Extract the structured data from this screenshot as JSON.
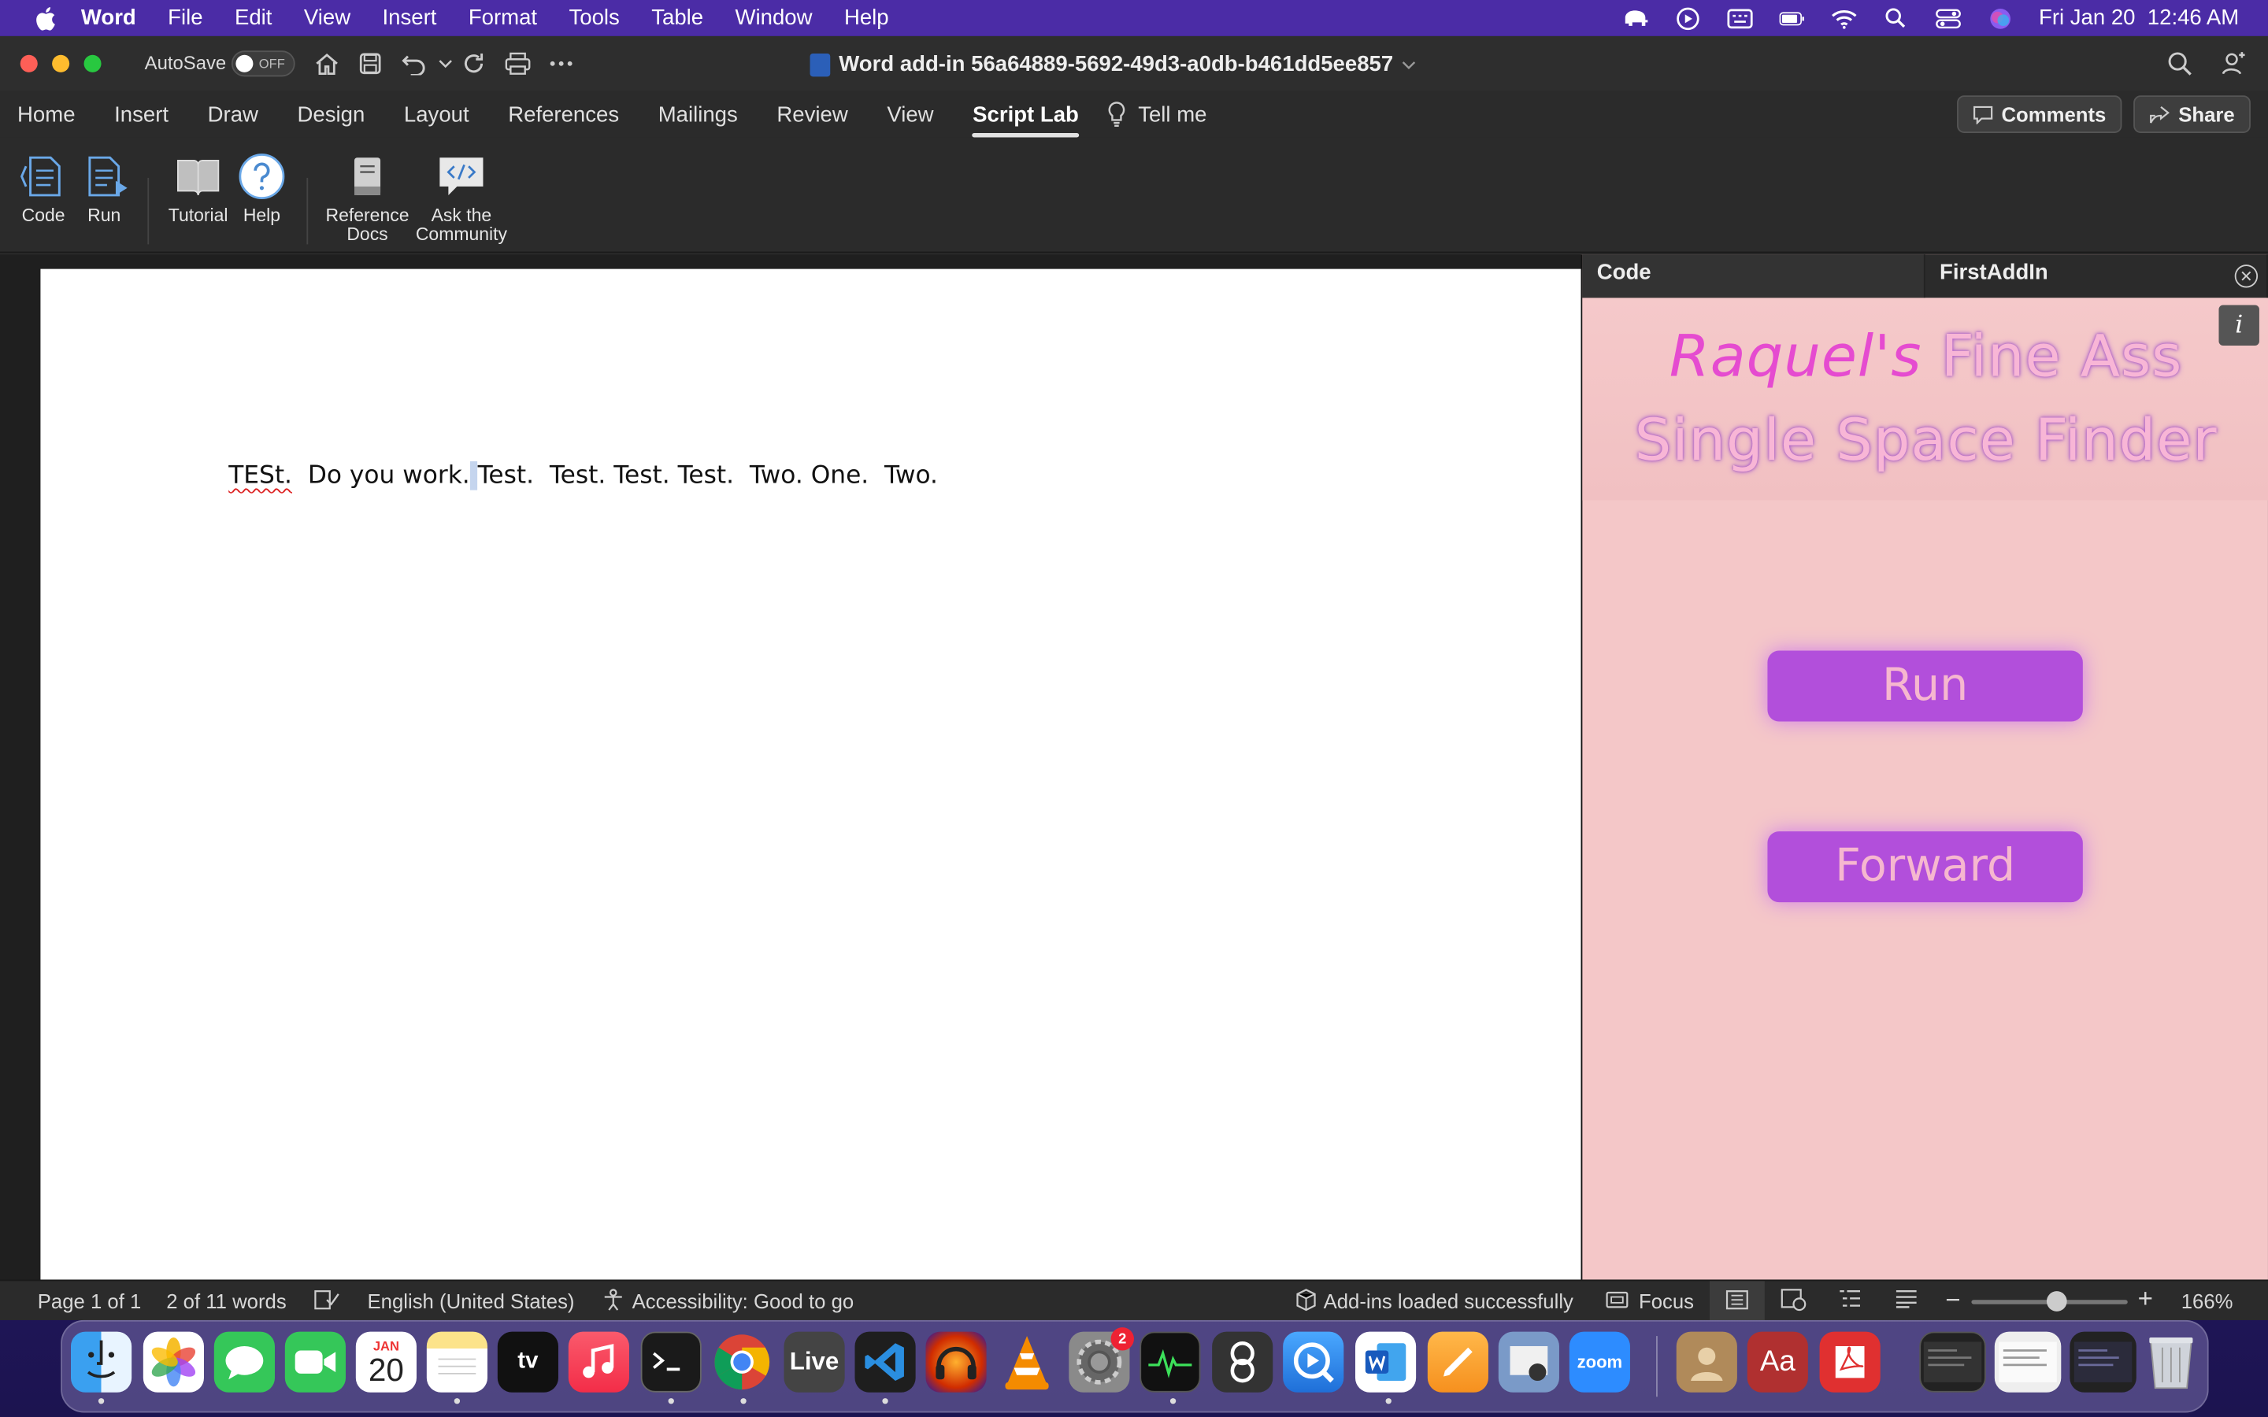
{
  "menubar": {
    "app_name": "Word",
    "items": [
      "File",
      "Edit",
      "View",
      "Insert",
      "Format",
      "Tools",
      "Table",
      "Window",
      "Help"
    ],
    "clock": "Fri Jan 20  12:46 AM"
  },
  "titlebar": {
    "autosave_label": "AutoSave",
    "toggle_state": "OFF",
    "doc_title": "Word add-in 56a64889-5692-49d3-a0db-b461dd5ee857"
  },
  "tabs": {
    "items": [
      "Home",
      "Insert",
      "Draw",
      "Design",
      "Layout",
      "References",
      "Mailings",
      "Review",
      "View",
      "Script Lab"
    ],
    "tell_me": "Tell me",
    "comments": "Comments",
    "share": "Share"
  },
  "ribbon": {
    "code": "Code",
    "run": "Run",
    "tutorial": "Tutorial",
    "help": "Help",
    "reference_docs_1": "Reference",
    "reference_docs_2": "Docs",
    "ask_1": "Ask the",
    "ask_2": "Community"
  },
  "document": {
    "word1": "TESt.",
    "text_a": "  Do you work.",
    "selected": " ",
    "text_b": "Test.  Test. Test. Test.  Two. One.  Two."
  },
  "pane": {
    "tab_code": "Code",
    "tab_addin": "FirstAddIn",
    "heading_name": "Raquel's",
    "heading_rest1": " Fine Ass",
    "heading_line2": "Single Space Finder",
    "run_button": "Run",
    "forward_button": "Forward"
  },
  "status": {
    "page": "Page 1 of 1",
    "words": "2 of 11 words",
    "language": "English (United States)",
    "accessibility": "Accessibility: Good to go",
    "addins": "Add-ins loaded successfully",
    "focus": "Focus",
    "zoom": "166%",
    "zoom_level": 0.55
  },
  "dock": {
    "calendar_month": "JAN",
    "calendar_day": "20",
    "appletv": "tv",
    "live": "Live",
    "zoom": "zoom",
    "dictionary": "Aa",
    "settings_badge": "2"
  }
}
